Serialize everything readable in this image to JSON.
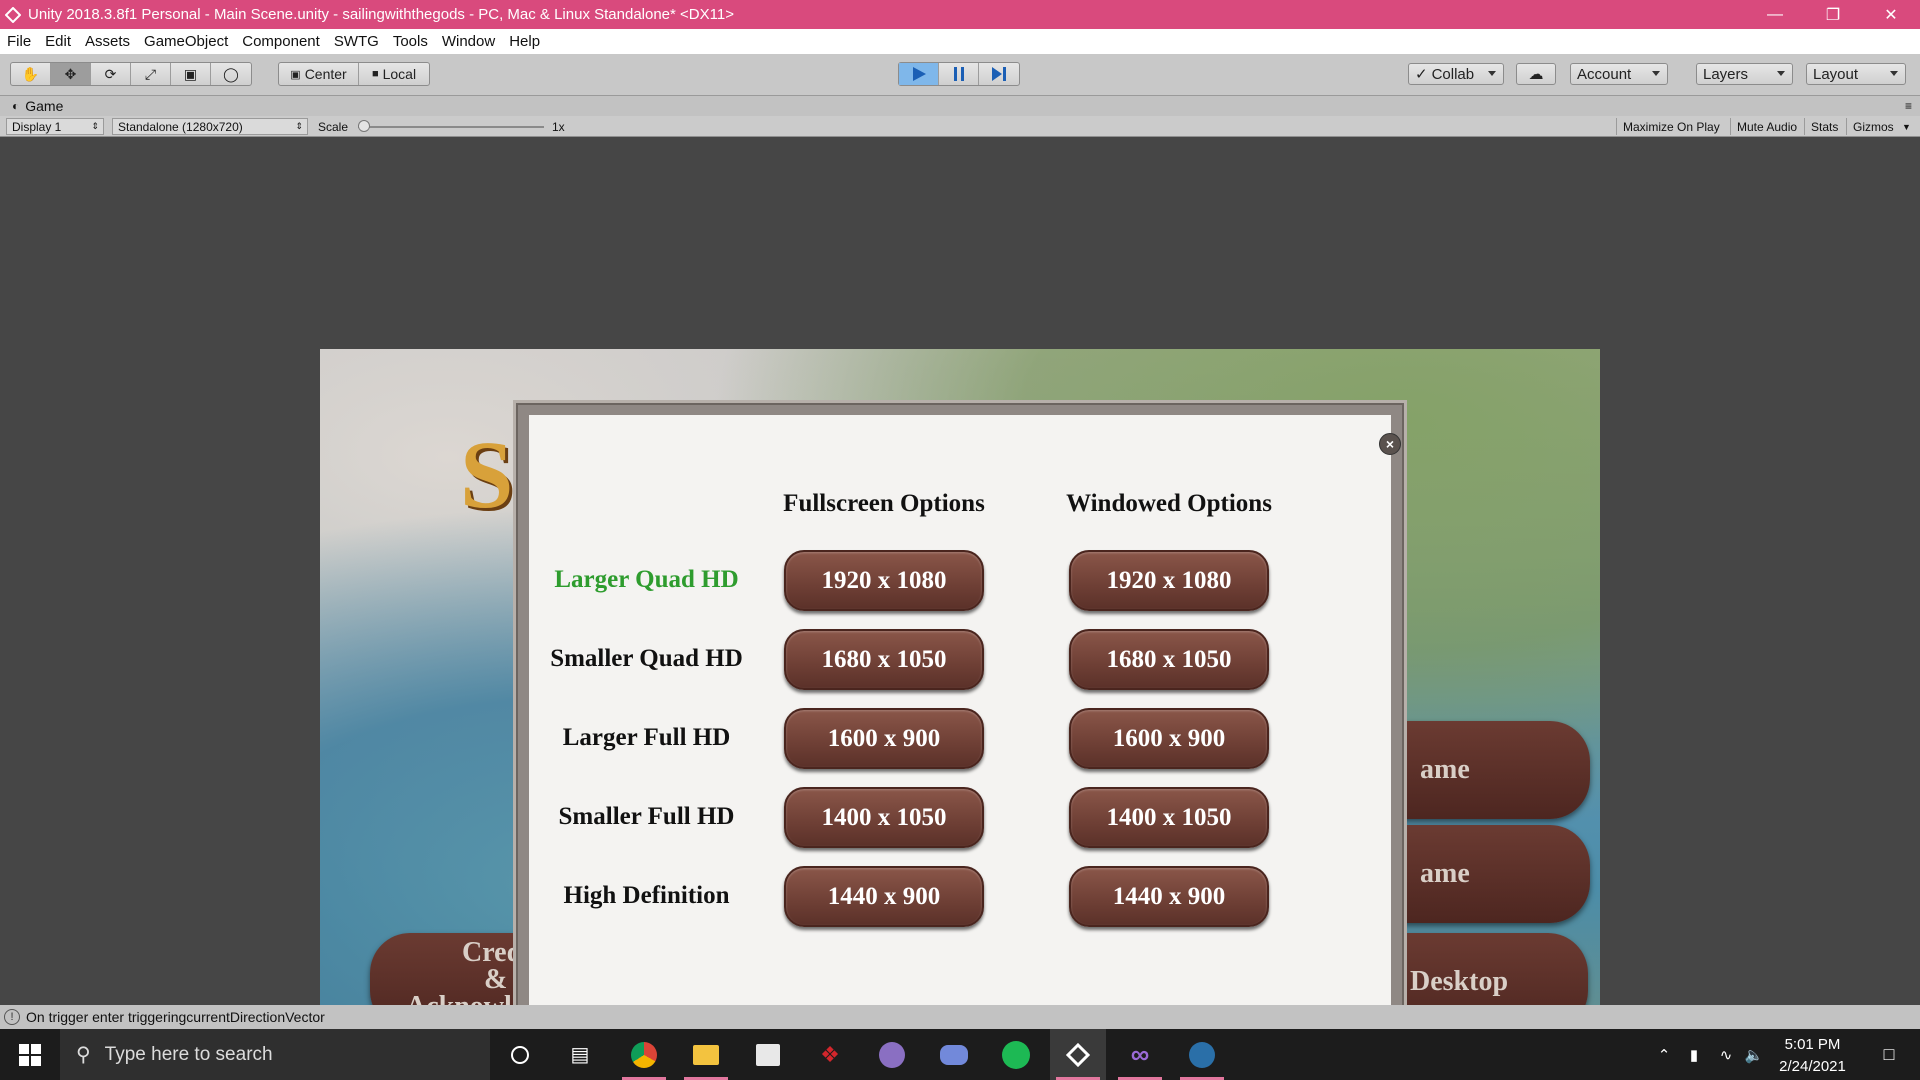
{
  "titlebar": {
    "title": "Unity 2018.3.8f1 Personal - Main Scene.unity - sailingwiththegods - PC, Mac & Linux Standalone* <DX11>"
  },
  "menu": [
    "File",
    "Edit",
    "Assets",
    "GameObject",
    "Component",
    "SWTG",
    "Tools",
    "Window",
    "Help"
  ],
  "toolbar": {
    "pivot_label": "Center",
    "space_label": "Local",
    "collab_label": "Collab",
    "account_label": "Account",
    "layers_label": "Layers",
    "layout_label": "Layout"
  },
  "game_tab": {
    "title": "Game",
    "display": "Display 1",
    "resolution": "Standalone (1280x720)",
    "scale_label": "Scale",
    "scale_value": "1x",
    "scale_fraction": 0.0,
    "maximize_on_play": "Maximize On Play",
    "mute_audio": "Mute Audio",
    "stats": "Stats",
    "gizmos": "Gizmos"
  },
  "background_menu": {
    "logo_fragment": "S",
    "btn_game_1": "ame",
    "btn_game_2": "ame",
    "btn_desktop": "Desktop",
    "btn_credits_l1": "Credi",
    "btn_credits_l2": "&",
    "btn_credits_l3": "Acknowle"
  },
  "dialog": {
    "close_label": "×",
    "fullscreen_header": "Fullscreen Options",
    "windowed_header": "Windowed Options",
    "rows": [
      {
        "label": "Larger Quad HD",
        "fullscreen": "1920 x 1080",
        "windowed": "1920 x 1080"
      },
      {
        "label": "Smaller Quad HD",
        "fullscreen": "1680 x 1050",
        "windowed": "1680 x 1050"
      },
      {
        "label": "Larger Full HD",
        "fullscreen": "1600 x 900",
        "windowed": "1600 x 900"
      },
      {
        "label": "Smaller Full HD",
        "fullscreen": "1400 x 1050",
        "windowed": "1400 x 1050"
      },
      {
        "label": "High Definition",
        "fullscreen": "1440 x 900",
        "windowed": "1440 x 900"
      }
    ],
    "highlight_color": "#2e9c2e"
  },
  "statusbar": {
    "message": "On trigger enter triggeringcurrentDirectionVector"
  },
  "taskbar": {
    "search_placeholder": "Type here to search",
    "apps": [
      "cortana-icon",
      "task-view-icon",
      "chrome-icon",
      "file-explorer-icon",
      "store-icon",
      "razer-icon",
      "github-icon",
      "discord-icon",
      "spotify-icon",
      "unity-icon",
      "visual-studio-icon",
      "steam-icon"
    ],
    "time": "5:01 PM",
    "date": "2/24/2021"
  },
  "colors": {
    "titlebar": "#d94a7d",
    "button_brown": "#6e3f35",
    "taskbar": "#1c1c1c"
  }
}
